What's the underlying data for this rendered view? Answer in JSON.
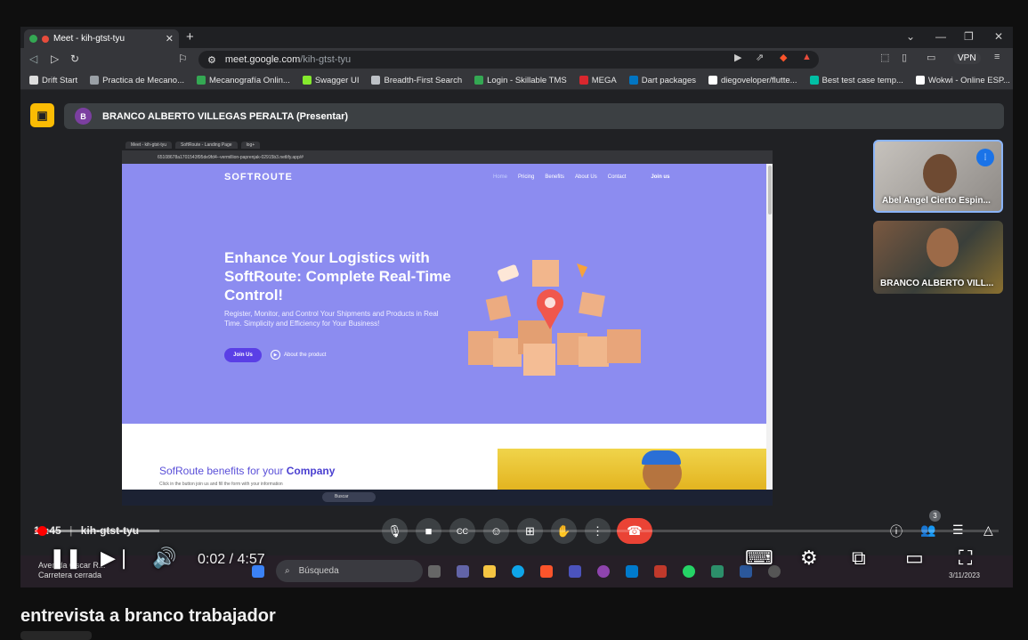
{
  "browser": {
    "tab_title": "Meet - kih-gtst-tyu",
    "url_host": "meet.google.com",
    "url_path": "/kih-gtst-tyu",
    "vpn_label": "VPN",
    "bookmarks": [
      {
        "label": "Drift Start",
        "color": "#dddddd"
      },
      {
        "label": "Practica de Mecano...",
        "color": "#9aa0a6"
      },
      {
        "label": "Mecanografía Onlin...",
        "color": "#34a853"
      },
      {
        "label": "Swagger UI",
        "color": "#85ea2d"
      },
      {
        "label": "Breadth-First Search",
        "color": "#bdc1c6"
      },
      {
        "label": "Login - Skillable TMS",
        "color": "#34a853"
      },
      {
        "label": "MEGA",
        "color": "#d9272e"
      },
      {
        "label": "Dart packages",
        "color": "#0175c2"
      },
      {
        "label": "diegoveloper/flutte...",
        "color": "#ffffff"
      },
      {
        "label": "Best test case temp...",
        "color": "#00bfa5"
      },
      {
        "label": "Wokwi - Online ESP...",
        "color": "#ffffff"
      }
    ]
  },
  "meet": {
    "presenter_initial": "B",
    "presenter_text": "BRANCO ALBERTO VILLEGAS PERALTA (Presentar)",
    "meeting_time": "10:45",
    "meeting_code": "kih-gtst-tyu",
    "participants": [
      {
        "name": "Abel Angel Cierto Espin..."
      },
      {
        "name": "BRANCO ALBERTO VILL..."
      }
    ],
    "people_count": "3",
    "accent": "#8ab4f8",
    "end_call_color": "#ea4335"
  },
  "shared_screen": {
    "tabs": [
      "Meet - kih-gtst-tyu",
      "SoftRoute - Landing Page",
      "log+"
    ],
    "address": "65108678a1701543f95de9fd4--vermillion-paprenjak-02915b3.netlify.app/#",
    "logo": "SOFTROUTE",
    "nav": [
      "Home",
      "Pricing",
      "Benefits",
      "About Us",
      "Contact",
      "Join us"
    ],
    "headline": "Enhance Your Logistics with SoftRoute: Complete Real-Time Control!",
    "subheadline": "Register, Monitor, and Control Your Shipments and Products in Real Time. Simplicity and Efficiency for Your Business!",
    "join_button": "Join Us",
    "about_link": "About the product",
    "benefits_title_prefix": "SofRoute benefits for your ",
    "benefits_title_bold": "Company",
    "benefits_sub": "Click in the button join us and fill the form with your information",
    "taskbar_search": "Buscar",
    "hero_color": "#8c8cf0",
    "button_color": "#5a3fe6"
  },
  "host_taskbar": {
    "weather_line1": "Avenida Óscar R...",
    "weather_line2": "Carretera cerrada",
    "search_placeholder": "Búsqueda",
    "date": "3/11/2023"
  },
  "youtube": {
    "current_time": "0:02",
    "duration": "4:57",
    "progress_fraction": 0.007,
    "video_title": "entrevista a branco trabajador"
  }
}
